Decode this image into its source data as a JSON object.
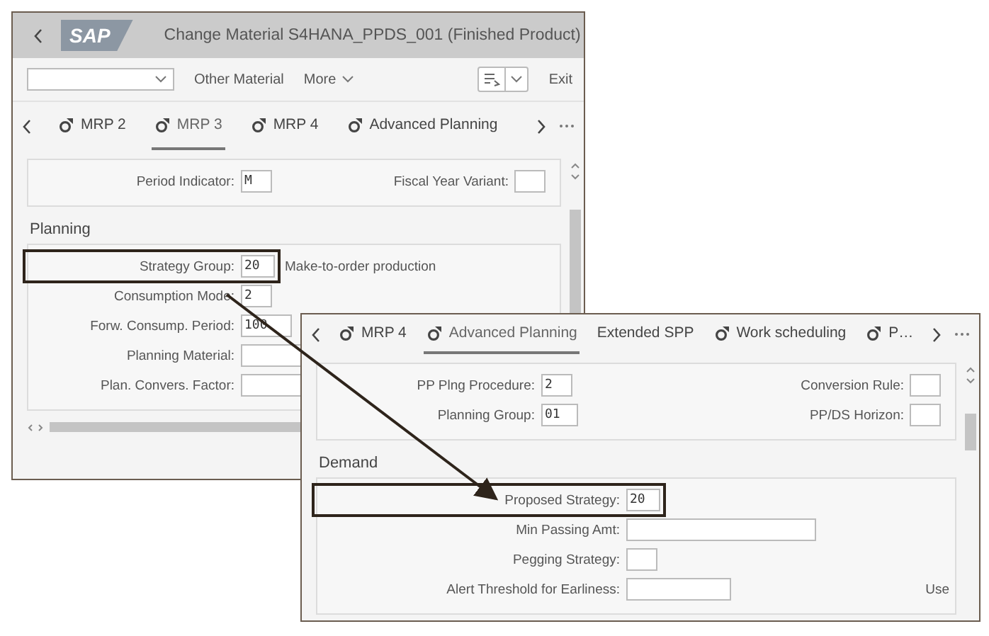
{
  "main_window": {
    "title": "Change Material S4HANA_PPDS_001 (Finished Product)",
    "logo": "SAP",
    "toolbar": {
      "actions": [
        "Other Material",
        "More"
      ],
      "exit": "Exit"
    },
    "tabs": [
      {
        "label": "MRP 2",
        "icon": true,
        "selected": false
      },
      {
        "label": "MRP 3",
        "icon": true,
        "selected": true
      },
      {
        "label": "MRP 4",
        "icon": true,
        "selected": false
      },
      {
        "label": "Advanced Planning",
        "icon": true,
        "selected": false
      }
    ],
    "sections": [
      {
        "rows": [
          {
            "label": "Period Indicator:",
            "value": "M",
            "highlighted": false,
            "right": {
              "label": "Fiscal Year Variant:"
            }
          }
        ]
      },
      {
        "title": "Planning",
        "rows": [
          {
            "label": "Strategy Group:",
            "value": "20",
            "highlighted": true,
            "description": "Make-to-order production"
          },
          {
            "label": "Consumption Mode:",
            "value": "2",
            "highlighted": false
          },
          {
            "label": "Forw. Consump. Period:",
            "value": "100",
            "highlighted": false
          },
          {
            "label": "Planning Material:",
            "highlighted": false
          },
          {
            "label": "Plan. Convers. Factor:",
            "highlighted": false
          }
        ]
      }
    ]
  },
  "detail_window": {
    "tabs": [
      {
        "label": "MRP 4",
        "icon": true,
        "selected": false
      },
      {
        "label": "Advanced Planning",
        "icon": true,
        "selected": true
      },
      {
        "label": "Extended SPP",
        "icon": false,
        "selected": false
      },
      {
        "label": "Work scheduling",
        "icon": true,
        "selected": false
      },
      {
        "label": "P…",
        "icon": true,
        "selected": false
      }
    ],
    "sections": [
      {
        "rows": [
          {
            "label": "PP Plng Procedure:",
            "value": "2",
            "highlighted": false,
            "right": {
              "label": "Conversion Rule:"
            }
          },
          {
            "label": "Planning Group:",
            "value": "01",
            "highlighted": false,
            "right": {
              "label": "PP/DS Horizon:"
            }
          }
        ]
      },
      {
        "title": "Demand",
        "rows": [
          {
            "label": "Proposed Strategy:",
            "value": "20",
            "highlighted": true
          },
          {
            "label": "Min Passing Amt:",
            "highlighted": false
          },
          {
            "label": "Pegging Strategy:",
            "highlighted": false
          },
          {
            "label": "Alert Threshold for Earliness:",
            "highlighted": false,
            "right_text": "Use"
          }
        ]
      }
    ]
  }
}
